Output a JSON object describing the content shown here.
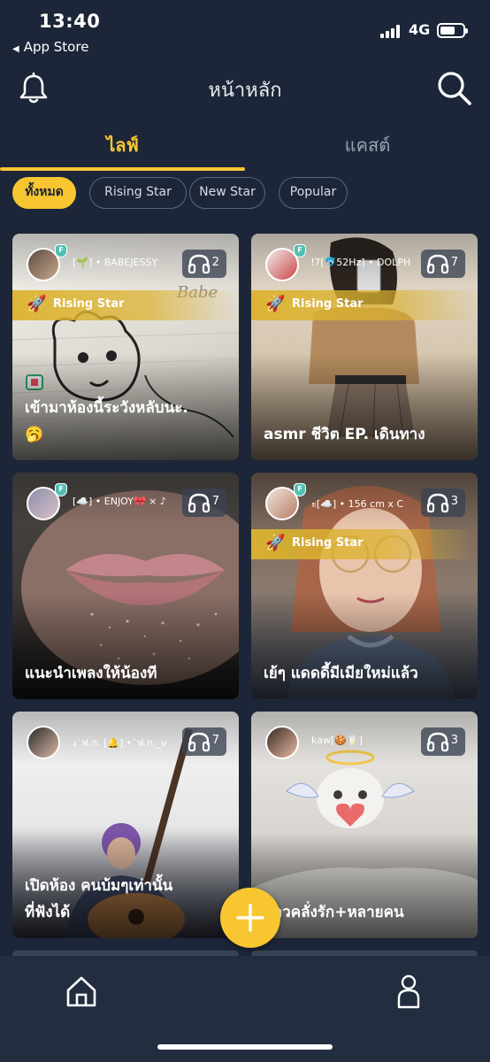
{
  "status_bar": {
    "time": "13:40",
    "back_label": "App Store",
    "network": "4G"
  },
  "header": {
    "title": "หน้าหลัก"
  },
  "tabs": [
    {
      "label": "ไลฟ์"
    },
    {
      "label": "แคสต์"
    }
  ],
  "filters": [
    {
      "label": "ทั้งหมด",
      "active": true
    },
    {
      "label": "Rising Star",
      "active": false
    },
    {
      "label": "New Star",
      "active": false
    },
    {
      "label": "Popular",
      "active": false
    }
  ],
  "badge_glyph": "F",
  "cards": [
    {
      "host": "[🌱] • BABEJESSY",
      "listeners": "2",
      "rising_star": true,
      "rising_label": "Rising Star",
      "title_line1": "เข้ามาห้องนี้ระวังหลับนะ.",
      "title_line2": "🥱"
    },
    {
      "host": "ǃ7[🐬52Hz] • DOLPH",
      "listeners": "7",
      "rising_star": true,
      "rising_label": "Rising Star",
      "title_line1": "asmr ชีวิต EP. เดินทาง",
      "title_line2": ""
    },
    {
      "host": "[☁️] • ENJOY🎀 × ♪",
      "listeners": "7",
      "rising_star": false,
      "title_line1": "แนะนำเพลงให้น้องที",
      "title_line2": ""
    },
    {
      "host": "ะ[☁️] • 156 cm x C",
      "listeners": "3",
      "rising_star": true,
      "rising_label": "Rising Star",
      "title_line1": "เย้ๆ แดดดี้มีเมียใหม่แล้ว",
      "title_line2": ""
    },
    {
      "host": "ɹ`ฟ.ก. [🔔] •`ฟ.ก._v",
      "listeners": "7",
      "rising_star": false,
      "title_line1": "เปิดห้อง คนบ้มๆเท่านั้น",
      "title_line2": "ที่ฟังได้"
    },
    {
      "host": "kaw[🍪🥛]",
      "listeners": "3",
      "rising_star": false,
      "title_line1": "ข้าวคลั่งรัก+หลายคน",
      "title_line2": ""
    }
  ],
  "colors": {
    "background": "#1c2638",
    "accent": "#f8c630",
    "nav": "#222d40"
  },
  "icons": [
    "bell-icon",
    "search-icon",
    "headphones-icon",
    "rocket-icon",
    "home-icon",
    "plus-icon",
    "profile-icon"
  ]
}
